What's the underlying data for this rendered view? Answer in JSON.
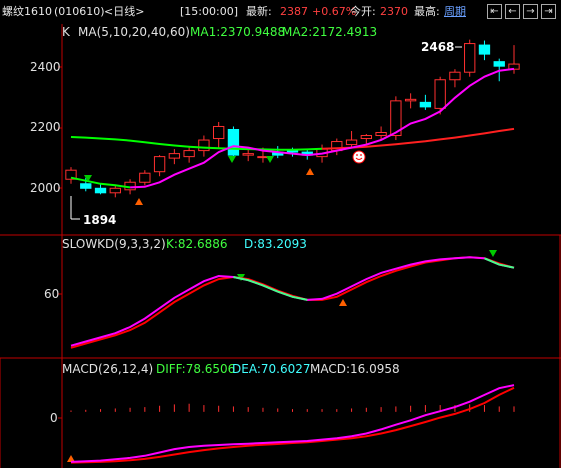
{
  "header": {
    "symbol_name": "螺纹1610",
    "symbol_code": "(010610)",
    "period_tag": "<日线>",
    "time_label": "[15:00:00]",
    "latest_label": "最新:",
    "latest_value": "2387",
    "change_pct": "+0.67%",
    "open_label": "今开:",
    "open_value": "2370",
    "high_label": "最高:",
    "period_link": "周期"
  },
  "colors": {
    "up": "#ff3030",
    "down": "#00ffff",
    "ma1": "#ff00ff",
    "ma2_green": "#00ff00",
    "ma2_red": "#ff2020",
    "kd_k": "#ff00ff",
    "kd_d": "#ff0000",
    "kd_green": "#44ff88",
    "diff": "#ff00ff",
    "dea": "#ff0000",
    "axis": "#c00000"
  },
  "price_panel": {
    "label_k": "K",
    "ma_title": "MA(5,10,20,40,60)",
    "ma1_text": "MA1:2370.9488",
    "ma2_text": "MA2:2172.4913",
    "y_ticks": [
      "2400",
      "2200",
      "2000"
    ],
    "max_note": "2468",
    "min_note": "1894",
    "ylim": [
      1830,
      2500
    ]
  },
  "kd_panel": {
    "title": "SLOWKD(9,3,3,2)",
    "k_text": "K:82.6886",
    "d_text": "D:83.2093",
    "y_ticks": [
      "60"
    ],
    "ylim": [
      0,
      100
    ]
  },
  "macd_panel": {
    "title": "MACD(26,12,4)",
    "diff_text": "DIFF:78.6506",
    "dea_text": "DEA:70.6027",
    "macd_text": "MACD:16.0958",
    "y_ticks": [
      "0"
    ]
  },
  "chart_data": [
    {
      "type": "candlestick",
      "title": "K MA(5,10,20,40,60)",
      "ylim": [
        1830,
        2500
      ],
      "y_ticks": [
        2000,
        2200,
        2400
      ],
      "candles": [
        {
          "o": 2005,
          "h": 2045,
          "l": 1990,
          "c": 2035
        },
        {
          "o": 1990,
          "h": 2010,
          "l": 1965,
          "c": 1975
        },
        {
          "o": 1975,
          "h": 1990,
          "l": 1955,
          "c": 1960
        },
        {
          "o": 1960,
          "h": 1985,
          "l": 1945,
          "c": 1975
        },
        {
          "o": 1970,
          "h": 2005,
          "l": 1955,
          "c": 1995
        },
        {
          "o": 1995,
          "h": 2035,
          "l": 1985,
          "c": 2025
        },
        {
          "o": 2030,
          "h": 2085,
          "l": 2015,
          "c": 2080
        },
        {
          "o": 2075,
          "h": 2105,
          "l": 2055,
          "c": 2090
        },
        {
          "o": 2080,
          "h": 2110,
          "l": 2060,
          "c": 2100
        },
        {
          "o": 2100,
          "h": 2150,
          "l": 2080,
          "c": 2135
        },
        {
          "o": 2140,
          "h": 2195,
          "l": 2110,
          "c": 2180
        },
        {
          "o": 2170,
          "h": 2180,
          "l": 2075,
          "c": 2085
        },
        {
          "o": 2085,
          "h": 2105,
          "l": 2065,
          "c": 2090
        },
        {
          "o": 2080,
          "h": 2110,
          "l": 2060,
          "c": 2080
        },
        {
          "o": 2095,
          "h": 2115,
          "l": 2075,
          "c": 2085
        },
        {
          "o": 2100,
          "h": 2110,
          "l": 2080,
          "c": 2095
        },
        {
          "o": 2095,
          "h": 2105,
          "l": 2070,
          "c": 2085
        },
        {
          "o": 2080,
          "h": 2120,
          "l": 2060,
          "c": 2105
        },
        {
          "o": 2100,
          "h": 2140,
          "l": 2085,
          "c": 2130
        },
        {
          "o": 2120,
          "h": 2165,
          "l": 2110,
          "c": 2135
        },
        {
          "o": 2140,
          "h": 2155,
          "l": 2120,
          "c": 2150
        },
        {
          "o": 2150,
          "h": 2180,
          "l": 2135,
          "c": 2160
        },
        {
          "o": 2150,
          "h": 2280,
          "l": 2135,
          "c": 2265
        },
        {
          "o": 2265,
          "h": 2290,
          "l": 2240,
          "c": 2270
        },
        {
          "o": 2260,
          "h": 2285,
          "l": 2235,
          "c": 2245
        },
        {
          "o": 2240,
          "h": 2345,
          "l": 2220,
          "c": 2335
        },
        {
          "o": 2335,
          "h": 2370,
          "l": 2310,
          "c": 2360
        },
        {
          "o": 2360,
          "h": 2468,
          "l": 2345,
          "c": 2455
        },
        {
          "o": 2450,
          "h": 2465,
          "l": 2400,
          "c": 2420
        },
        {
          "o": 2395,
          "h": 2405,
          "l": 2330,
          "c": 2380
        },
        {
          "o": 2370,
          "h": 2450,
          "l": 2355,
          "c": 2387
        }
      ],
      "ma1": [
        2010,
        2000,
        1990,
        1985,
        1978,
        1980,
        1995,
        2020,
        2040,
        2060,
        2095,
        2115,
        2110,
        2100,
        2095,
        2090,
        2085,
        2090,
        2100,
        2110,
        2120,
        2135,
        2160,
        2190,
        2205,
        2230,
        2275,
        2315,
        2345,
        2365,
        2371
      ],
      "ma2": [
        2145,
        2143,
        2140,
        2137,
        2133,
        2128,
        2122,
        2117,
        2113,
        2110,
        2108,
        2106,
        2105,
        2104,
        2103,
        2103,
        2104,
        2106,
        2108,
        2110,
        2113,
        2117,
        2121,
        2126,
        2131,
        2137,
        2143,
        2150,
        2157,
        2165,
        2172
      ]
    },
    {
      "type": "line",
      "title": "SLOWKD(9,3,3,2)",
      "ylim": [
        0,
        100
      ],
      "y_ticks": [
        60
      ],
      "series": [
        {
          "name": "K",
          "values": [
            8,
            12,
            16,
            20,
            26,
            34,
            44,
            54,
            62,
            70,
            75,
            74,
            71,
            66,
            60,
            55,
            52,
            53,
            58,
            65,
            72,
            78,
            82,
            86,
            89,
            91,
            92,
            93,
            92,
            86,
            83
          ]
        },
        {
          "name": "D",
          "values": [
            6,
            10,
            14,
            18,
            23,
            30,
            40,
            50,
            58,
            66,
            72,
            74,
            72,
            67,
            61,
            56,
            52,
            52,
            55,
            62,
            69,
            75,
            80,
            84,
            88,
            90,
            92,
            93,
            92,
            87,
            83
          ]
        }
      ]
    },
    {
      "type": "line",
      "title": "MACD(26,12,4)",
      "ylim": [
        -160,
        100
      ],
      "y_ticks": [
        0
      ],
      "series": [
        {
          "name": "DIFF",
          "values": [
            -148,
            -146,
            -144,
            -140,
            -136,
            -130,
            -120,
            -110,
            -104,
            -100,
            -98,
            -96,
            -94,
            -92,
            -90,
            -88,
            -86,
            -82,
            -78,
            -72,
            -64,
            -52,
            -38,
            -25,
            -10,
            2,
            14,
            30,
            50,
            70,
            79
          ]
        },
        {
          "name": "DEA",
          "values": [
            -150,
            -149,
            -148,
            -146,
            -143,
            -139,
            -133,
            -126,
            -119,
            -113,
            -108,
            -104,
            -100,
            -97,
            -95,
            -92,
            -90,
            -86,
            -82,
            -78,
            -72,
            -64,
            -54,
            -42,
            -30,
            -17,
            -6,
            8,
            26,
            50,
            71
          ]
        },
        {
          "name": "MACD",
          "values": [
            4,
            6,
            8,
            10,
            12,
            14,
            18,
            22,
            24,
            20,
            18,
            16,
            14,
            12,
            10,
            8,
            8,
            8,
            8,
            10,
            12,
            14,
            16,
            18,
            20,
            20,
            20,
            22,
            20,
            16,
            16
          ]
        }
      ]
    }
  ]
}
